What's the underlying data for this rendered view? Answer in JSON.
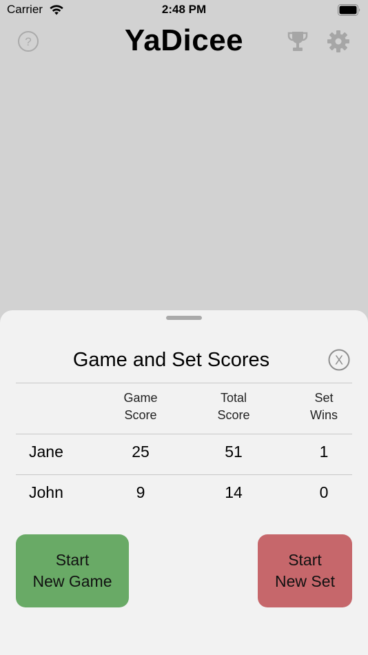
{
  "status_bar": {
    "carrier": "Carrier",
    "time": "2:48 PM"
  },
  "header": {
    "title": "YaDicee",
    "icons": [
      "question-circle-icon",
      "trophy-icon",
      "gear-icon"
    ]
  },
  "sheet": {
    "title": "Game and Set Scores",
    "close_icon": "x-circle-icon",
    "columns": {
      "game_score": [
        "Game",
        "Score"
      ],
      "total_score": [
        "Total",
        "Score"
      ],
      "set_wins": [
        "Set",
        "Wins"
      ]
    },
    "rows": [
      {
        "name": "Jane",
        "game_score": "25",
        "total_score": "51",
        "set_wins": "1"
      },
      {
        "name": "John",
        "game_score": "9",
        "total_score": "14",
        "set_wins": "0"
      }
    ],
    "buttons": {
      "new_game": [
        "Start",
        "New Game"
      ],
      "new_set": [
        "Start",
        "New Set"
      ]
    }
  },
  "colors": {
    "background": "#d2d2d2",
    "sheet": "#f2f2f2",
    "new_game_button": "#69aa66",
    "new_set_button": "#c6676b",
    "icon_gray": "#a6a6a6"
  }
}
